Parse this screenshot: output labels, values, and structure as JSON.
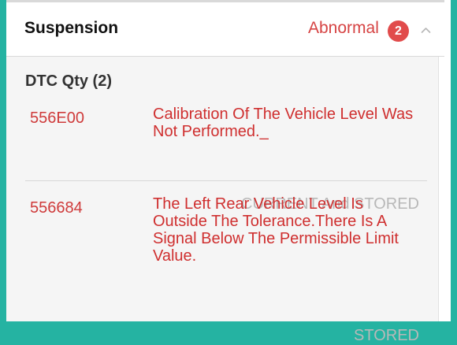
{
  "header": {
    "title": "Suspension",
    "status": "Abnormal",
    "badge_count": "2",
    "chevron_icon": "chevron-up-icon"
  },
  "dtc": {
    "title": "DTC Qty (2)",
    "items": [
      {
        "code": "556E00",
        "description": "Calibration Of The Vehicle Level Was Not Performed._",
        "state": "CURRENT And STORED"
      },
      {
        "code": "556684",
        "description": "The Left Rear Vehicle Level Is Outside The Tolerance.There Is A Signal Below The Permissible Limit Value.",
        "state": "STORED"
      }
    ]
  },
  "colors": {
    "outer_background": "#25b3a2",
    "panel_background": "#f5f5f5",
    "abnormal": "#d64343",
    "badge": "#e14b4b",
    "description": "#cf2f2f",
    "state": "#b8b8b8"
  }
}
